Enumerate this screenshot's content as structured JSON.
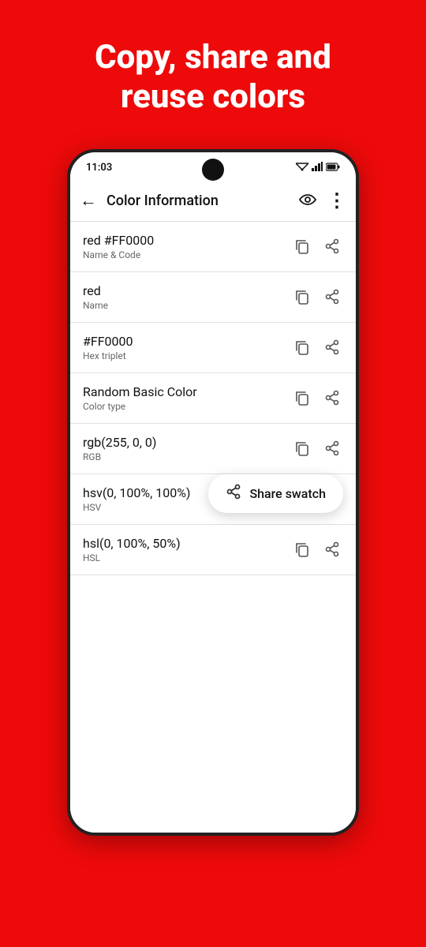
{
  "hero": {
    "title": "Copy, share and\nreuse colors"
  },
  "statusBar": {
    "time": "11:03",
    "signal": "▲▲",
    "battery": "▉"
  },
  "appBar": {
    "title": "Color Information",
    "backIcon": "←",
    "eyeIcon": "👁",
    "moreIcon": "⋮"
  },
  "colorRows": [
    {
      "value": "red #FF0000",
      "label": "Name & Code"
    },
    {
      "value": "red",
      "label": "Name"
    },
    {
      "value": "#FF0000",
      "label": "Hex triplet"
    },
    {
      "value": "Random Basic Color",
      "label": "Color type"
    },
    {
      "value": "rgb(255, 0, 0)",
      "label": "RGB"
    },
    {
      "value": "hsv(0, 100%, 100%)",
      "label": "HSV"
    },
    {
      "value": "hsl(0, 100%, 50%)",
      "label": "HSL"
    }
  ],
  "shareSwatchPopup": {
    "label": "Share swatch",
    "icon": "share"
  }
}
